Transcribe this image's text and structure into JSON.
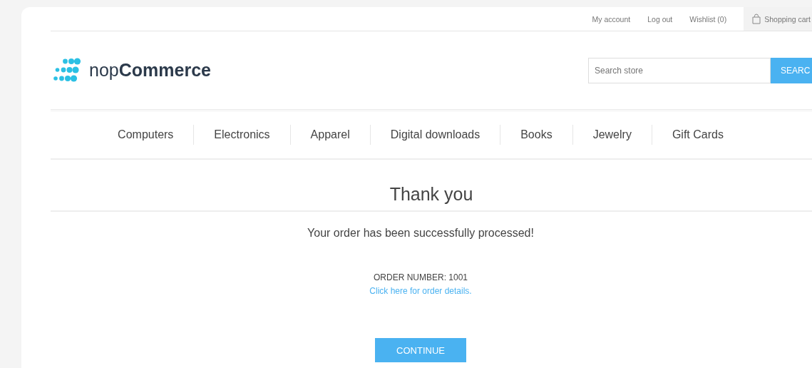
{
  "header_links": [
    {
      "label": "My account"
    },
    {
      "label": "Log out"
    },
    {
      "label": "Wishlist (0)"
    }
  ],
  "cart": {
    "label": "Shopping cart"
  },
  "logo": {
    "prefix": "nop",
    "name": "Commerce"
  },
  "search": {
    "placeholder": "Search store",
    "button": "SEARC"
  },
  "menu": [
    {
      "label": "Computers"
    },
    {
      "label": "Electronics"
    },
    {
      "label": "Apparel"
    },
    {
      "label": "Digital downloads"
    },
    {
      "label": "Books"
    },
    {
      "label": "Jewelry"
    },
    {
      "label": "Gift Cards"
    }
  ],
  "page": {
    "title": "Thank you",
    "message": "Your order has been successfully processed!",
    "order_number": "ORDER NUMBER: 1001",
    "details_link": "Click here for order details.",
    "button": "CONTINUE"
  }
}
